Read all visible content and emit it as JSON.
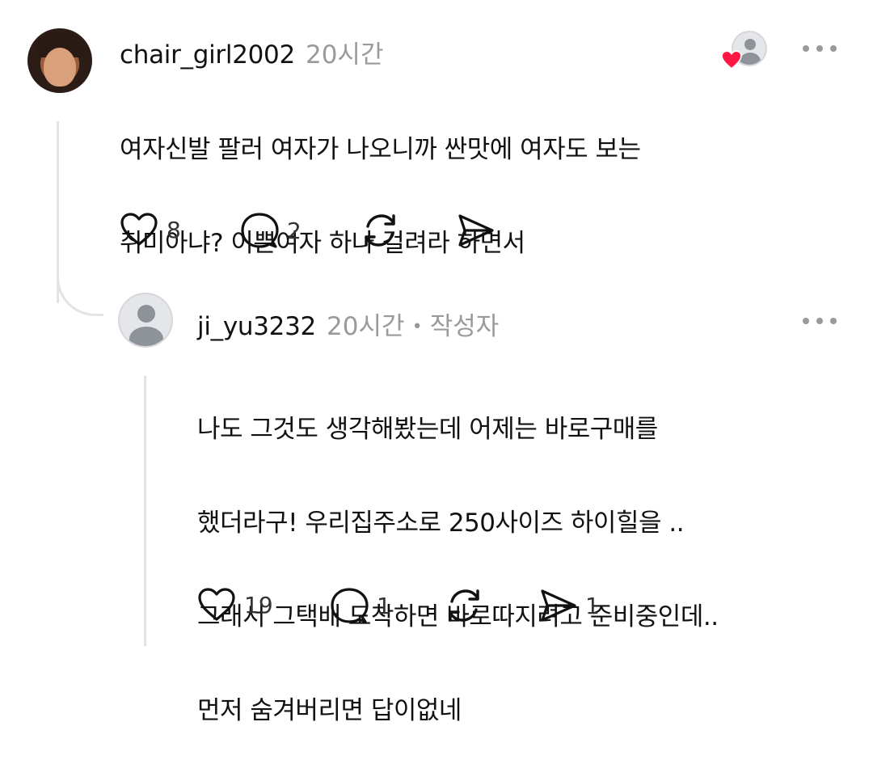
{
  "comment": {
    "username": "chair_girl2002",
    "time": "20시간",
    "text_line1": "여자신발 팔러 여자가 나오니까 싼맛에 여자도 보는",
    "text_line2": "취미아냐? 이쁜여자 하나 걸려라 하면서",
    "likes": "8",
    "replies": "2",
    "icons": {
      "like": "heart-icon",
      "reply": "comment-icon",
      "repost": "repost-icon",
      "share": "send-icon",
      "more": "more-icon",
      "liked_by": "heart-badge-icon"
    }
  },
  "reply": {
    "username": "ji_yu3232",
    "time": "20시간",
    "separator": "•",
    "author_badge": "작성자",
    "text_line1": "나도 그것도 생각해봤는데 어제는 바로구매를",
    "text_line2": "했더라구! 우리집주소로 250사이즈 하이힐을 ..",
    "text_line3": "그래서 그택배 도착하면 바로따지려고 준비중인데..",
    "text_line4": "먼저 숨겨버리면 답이없네",
    "likes": "19",
    "replies": "1",
    "shares": "1"
  },
  "colors": {
    "text": "#111111",
    "muted": "#9a9a9a",
    "heart": "#ff1744",
    "thread_line": "#e3e3e3"
  }
}
